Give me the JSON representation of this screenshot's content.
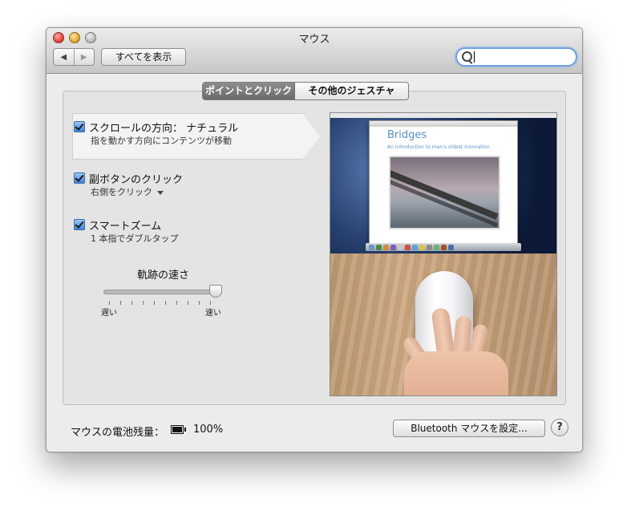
{
  "window": {
    "title": "マウス"
  },
  "toolbar": {
    "back_icon": "◀",
    "forward_icon": "▶",
    "show_all_label": "すべてを表示",
    "search_placeholder": ""
  },
  "tabs": [
    {
      "label": "ポイントとクリック",
      "active": true
    },
    {
      "label": "その他のジェスチャ",
      "active": false
    }
  ],
  "options": [
    {
      "title": "スクロールの方向： ナチュラル",
      "subtitle": "指を動かす方向にコンテンツが移動",
      "checked": true
    },
    {
      "title": "副ボタンのクリック",
      "subtitle": "右側をクリック",
      "checked": true,
      "has_dropdown": true
    },
    {
      "title": "スマートズーム",
      "subtitle": "1 本指でダブルタップ",
      "checked": true
    }
  ],
  "tracking": {
    "label": "軌跡の速さ",
    "min_label": "遅い",
    "max_label": "速い",
    "value_fraction": 1.0
  },
  "preview": {
    "window_title": "Bridges",
    "window_subtitle": "An introduction to man's oldest innovation"
  },
  "footer": {
    "battery_label": "マウスの電池残量：",
    "battery_value": "100%",
    "bluetooth_button": "Bluetooth マウスを設定...",
    "help_label": "?"
  },
  "colors": {
    "accent": "#3c82d6",
    "search_focus": "#6fa2df"
  }
}
